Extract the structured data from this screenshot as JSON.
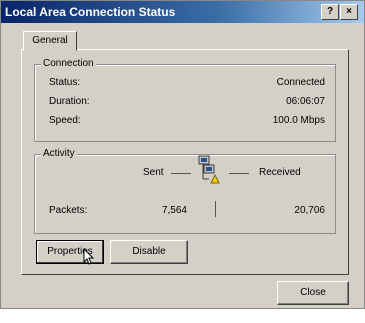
{
  "window": {
    "title": "Local Area Connection Status",
    "help_label": "?",
    "close_label": "×"
  },
  "tabs": [
    {
      "label": "General"
    }
  ],
  "connection": {
    "group_label": "Connection",
    "rows": [
      {
        "label": "Status:",
        "value": "Connected"
      },
      {
        "label": "Duration:",
        "value": "06:06:07"
      },
      {
        "label": "Speed:",
        "value": "100.0 Mbps"
      }
    ]
  },
  "activity": {
    "group_label": "Activity",
    "sent_label": "Sent",
    "received_label": "Received",
    "packets_label": "Packets:",
    "packets_sent": "7,564",
    "packets_received": "20,706"
  },
  "buttons": {
    "properties": "Properties",
    "disable": "Disable",
    "close": "Close"
  },
  "colors": {
    "titlebar_start": "#0a246a",
    "titlebar_end": "#a6caf0",
    "dialog_bg": "#d4d0c8"
  },
  "icons": [
    "network-computers-icon",
    "mouse-cursor-icon"
  ]
}
